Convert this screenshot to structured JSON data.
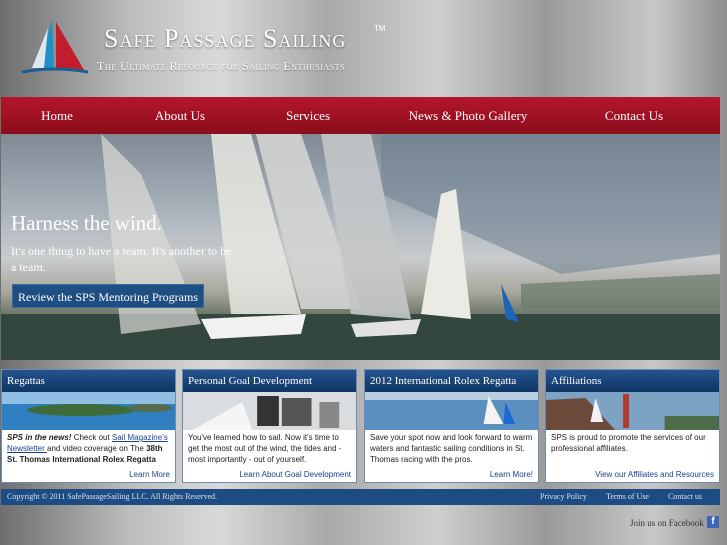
{
  "brand": {
    "name": "Safe Passage Sailing",
    "trademark": "TM",
    "tagline": "The Ultimate Resource for Sailing Enthusiasts",
    "logo_icon": "sailboat-logo-icon"
  },
  "nav": {
    "items": [
      {
        "label": "Home"
      },
      {
        "label": "About Us"
      },
      {
        "label": "Services"
      },
      {
        "label": "News & Photo Gallery"
      },
      {
        "label": "Contact Us"
      }
    ]
  },
  "hero": {
    "title": "Harness the wind.",
    "text": "It's one thing to have a team. It's another to be a team.",
    "button": "Review the SPS Mentoring Programs"
  },
  "cards": [
    {
      "title": "Regattas",
      "body_strong": "SPS in the news!",
      "body_pre": " Check out ",
      "body_link": "Sail Magazine's Newsletter ",
      "body_mid": "and video coverage on The ",
      "body_strong2": "38th St. Thomas International Rolex Regatta",
      "link": "Learn More"
    },
    {
      "title": "Personal Goal Development",
      "body": "You've learned how to sail. Now it's time to get the most out of the wind, the tides and - most importantly - out of yourself.",
      "link": "Learn About Goal Development"
    },
    {
      "title": "2012 International Rolex Regatta",
      "body": "Save your spot now and look forward to warm waters and fantastic sailing conditions in St. Thomas racing with the pros.",
      "link": "Learn More!"
    },
    {
      "title": "Affiliations",
      "body": "SPS is proud to promote the services of our professional affiliates.",
      "link": "View our Affiliates and Resources"
    }
  ],
  "footer": {
    "copyright": "Copyright © 2011 SafePassageSailing LLC. All Rights Reserved.",
    "links": [
      "Privacy Policy",
      "Terms of Use",
      "Contact us"
    ]
  },
  "social": {
    "text": "Join us on Facebook",
    "icon": "facebook-icon"
  },
  "colors": {
    "nav": "#a01224",
    "card_header": "#1c4c83",
    "footer": "#1c4c83",
    "button": "#1f4e82"
  }
}
